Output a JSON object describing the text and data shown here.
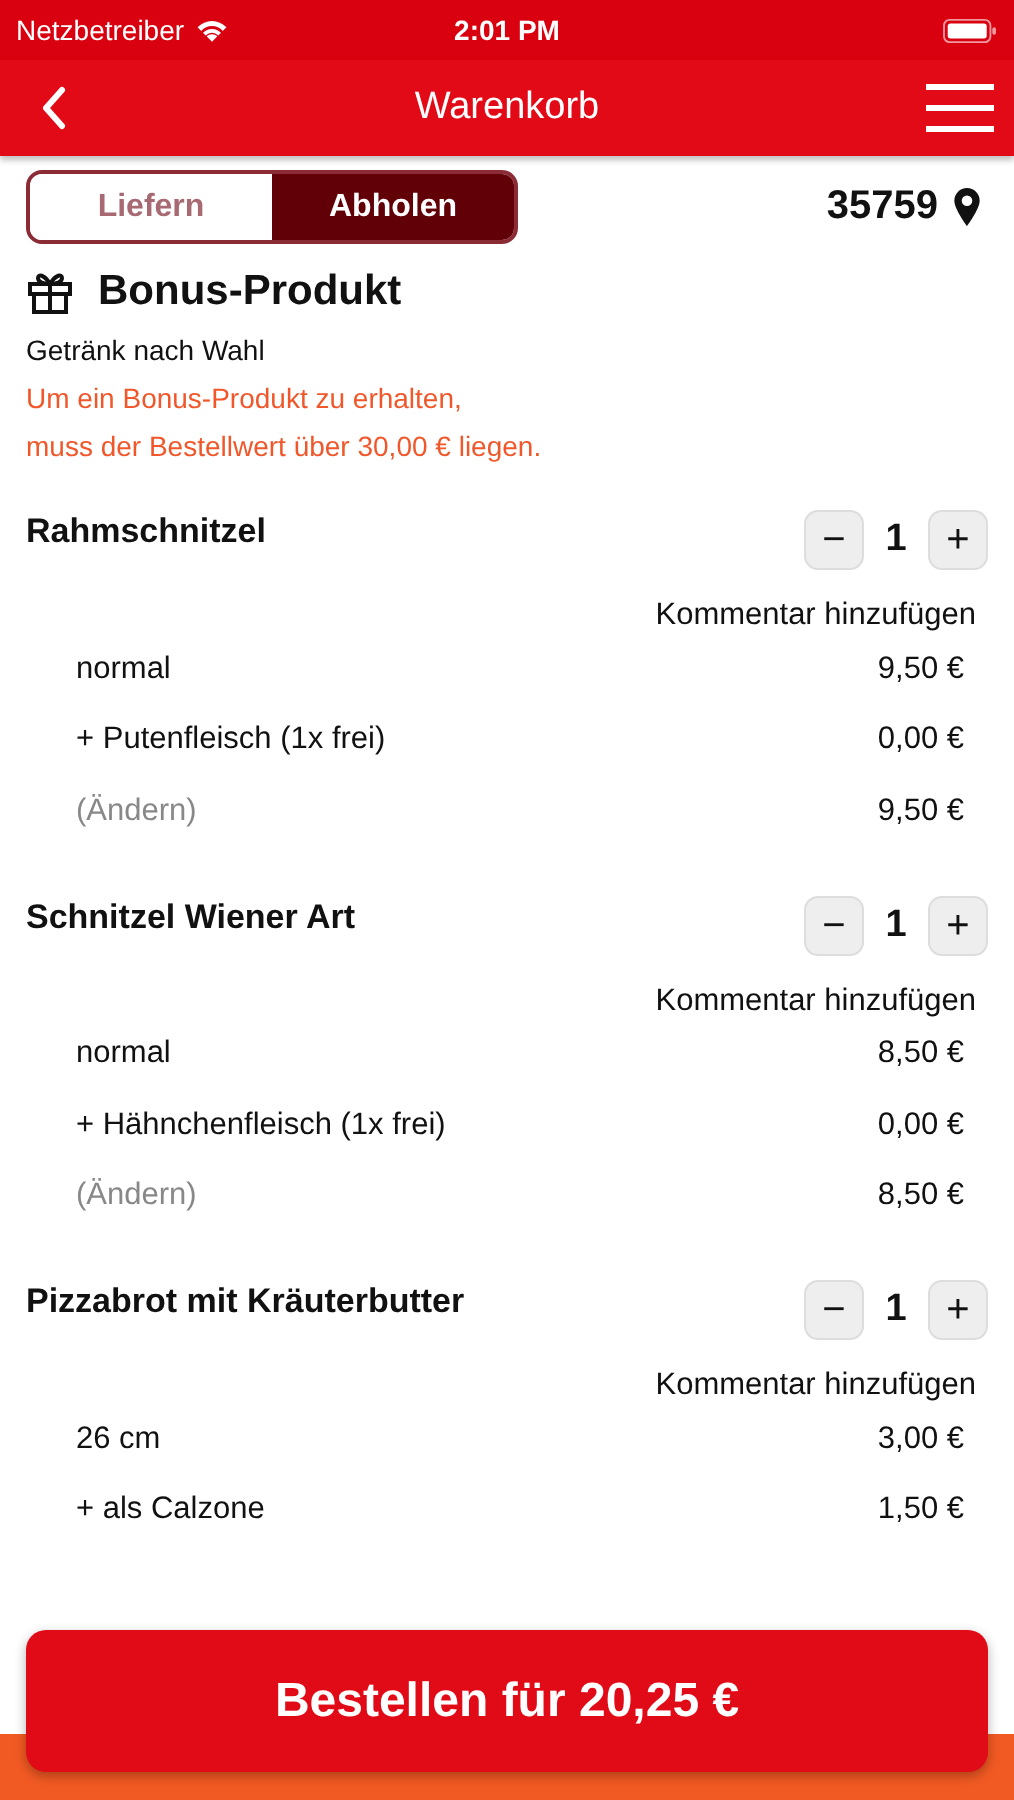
{
  "status_bar": {
    "carrier": "Netzbetreiber",
    "time": "2:01 PM"
  },
  "nav": {
    "title": "Warenkorb"
  },
  "mode_tabs": [
    {
      "label": "Liefern",
      "selected": false
    },
    {
      "label": "Abholen",
      "selected": true
    }
  ],
  "postcode": "35759",
  "bonus": {
    "title": "Bonus-Produkt",
    "subtitle": "Getränk nach Wahl",
    "notice": [
      "Um ein Bonus-Produkt zu erhalten,",
      "muss der Bestellwert über 30,00 € liegen."
    ]
  },
  "items": [
    {
      "name": "Rahmschnitzel",
      "minus": "−",
      "quantity": "1",
      "plus": "+",
      "comment_link": "Kommentar hinzufügen",
      "rows": [
        {
          "kind": "option",
          "label": "normal",
          "price": "9,50 €"
        },
        {
          "kind": "option",
          "label": "+ Putenfleisch (1x frei)",
          "price": "0,00 €"
        },
        {
          "kind": "change",
          "label": "(Ändern)",
          "price": "9,50 €"
        }
      ]
    },
    {
      "name": "Schnitzel Wiener Art",
      "minus": "−",
      "quantity": "1",
      "plus": "+",
      "comment_link": "Kommentar hinzufügen",
      "rows": [
        {
          "kind": "option",
          "label": "normal",
          "price": "8,50 €"
        },
        {
          "kind": "option",
          "label": "+ Hähnchenfleisch (1x frei)",
          "price": "0,00 €"
        },
        {
          "kind": "change",
          "label": "(Ändern)",
          "price": "8,50 €"
        }
      ]
    },
    {
      "name": "Pizzabrot mit Kräuterbutter",
      "minus": "−",
      "quantity": "1",
      "plus": "+",
      "comment_link": "Kommentar hinzufügen",
      "rows": [
        {
          "kind": "option",
          "label": "26 cm",
          "price": "3,00 €"
        },
        {
          "kind": "option",
          "label": "+ als Calzone",
          "price": "1,50 €"
        }
      ]
    }
  ],
  "order_button": "Bestellen für 20,25 €"
}
